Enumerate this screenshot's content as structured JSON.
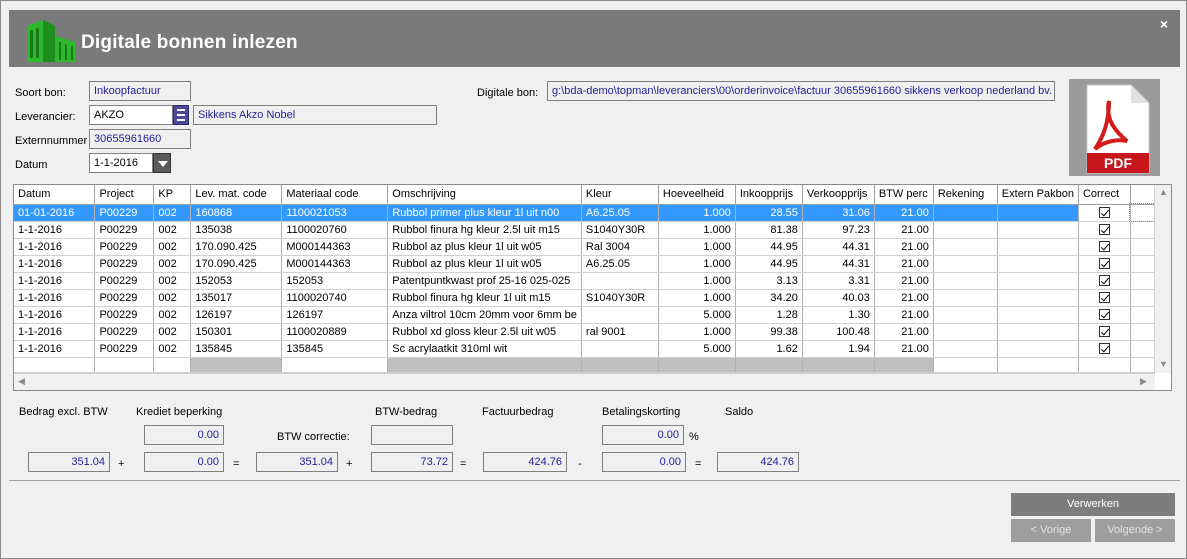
{
  "window": {
    "title": "Digitale bonnen inlezen",
    "close_glyph": "×"
  },
  "form": {
    "soort_bon_label": "Soort bon:",
    "soort_bon_value": "Inkoopfactuur",
    "leverancier_label": "Leverancier:",
    "leverancier_code": "AKZO",
    "leverancier_name": "Sikkens Akzo Nobel",
    "externnummer_label": "Externnummer",
    "externnummer_value": "30655961660",
    "datum_label": "Datum",
    "datum_value": "1-1-2016",
    "digitale_bon_label": "Digitale bon:",
    "digitale_bon_value": "g:\\bda-demo\\topman\\leveranciers\\00\\orderinvoice\\factuur 30655961660 sikkens verkoop nederland bv.",
    "pdf_icon": "pdf-file-icon"
  },
  "grid": {
    "columns": [
      "Datum",
      "Project",
      "KP",
      "Lev. mat. code",
      "Materiaal code",
      "Omschrijving",
      "Kleur",
      "Hoeveelheid",
      "Inkoopprijs",
      "Verkoopprijs",
      "BTW perc",
      "Rekening",
      "Extern Pakbon",
      "Correct"
    ],
    "rows": [
      [
        "01-01-2016",
        "P00229",
        "002",
        "160868",
        "1100021053",
        "Rubbol primer plus kleur 1l uit n00",
        "A6.25.05",
        "1.000",
        "28.55",
        "31.06",
        "21.00",
        "",
        ""
      ],
      [
        "1-1-2016",
        "P00229",
        "002",
        "135038",
        "1100020760",
        "Rubbol finura hg kleur 2.5l uit m15",
        "S1040Y30R",
        "1.000",
        "81.38",
        "97.23",
        "21.00",
        "",
        ""
      ],
      [
        "1-1-2016",
        "P00229",
        "002",
        "170.090.425",
        "M000144363",
        "Rubbol az plus kleur 1l uit w05",
        "Ral 3004",
        "1.000",
        "44.95",
        "44.31",
        "21.00",
        "",
        ""
      ],
      [
        "1-1-2016",
        "P00229",
        "002",
        "170.090.425",
        "M000144363",
        "Rubbol az plus kleur 1l uit w05",
        "A6.25.05",
        "1.000",
        "44.95",
        "44.31",
        "21.00",
        "",
        ""
      ],
      [
        "1-1-2016",
        "P00229",
        "002",
        "152053",
        "152053",
        "Patentpuntkwast prof 25-16 025-025",
        "",
        "1.000",
        "3.13",
        "3.31",
        "21.00",
        "",
        ""
      ],
      [
        "1-1-2016",
        "P00229",
        "002",
        "135017",
        "1100020740",
        "Rubbol finura hg kleur 1l uit m15",
        "S1040Y30R",
        "1.000",
        "34.20",
        "40.03",
        "21.00",
        "",
        ""
      ],
      [
        "1-1-2016",
        "P00229",
        "002",
        "126197",
        "126197",
        "Anza viltrol 10cm 20mm voor 6mm be",
        "",
        "5.000",
        "1.28",
        "1.30",
        "21.00",
        "",
        ""
      ],
      [
        "1-1-2016",
        "P00229",
        "002",
        "150301",
        "1100020889",
        "Rubbol xd gloss kleur 2.5l uit w05",
        "ral 9001",
        "1.000",
        "99.38",
        "100.48",
        "21.00",
        "",
        ""
      ],
      [
        "1-1-2016",
        "P00229",
        "002",
        "135845",
        "135845",
        "Sc acrylaatkit 310ml wit",
        "",
        "5.000",
        "1.62",
        "1.94",
        "21.00",
        "",
        ""
      ]
    ],
    "correct_checked": [
      true,
      true,
      true,
      true,
      true,
      true,
      true,
      true,
      true
    ]
  },
  "totals": {
    "bedrag_excl_label": "Bedrag excl. BTW",
    "krediet_label": "Krediet beperking",
    "btw_bedrag_label": "BTW-bedrag",
    "factuur_label": "Factuurbedrag",
    "betalingskorting_label": "Betalingskorting",
    "saldo_label": "Saldo",
    "btw_correctie_label": "BTW correctie:",
    "krediet_top": "0.00",
    "btw_correctie_value": "",
    "korting_percent": "0.00",
    "percent_sign": "%",
    "bedrag_excl": "351.04",
    "krediet": "0.00",
    "subtotal": "351.04",
    "btw_bedrag": "73.72",
    "factuurbedrag": "424.76",
    "korting": "0.00",
    "saldo": "424.76",
    "op_plus1": "+",
    "op_eq1": "=",
    "op_plus2": "+",
    "op_eq2": "=",
    "op_minus": "-",
    "op_eq3": "="
  },
  "buttons": {
    "verwerken": "Verwerken",
    "vorige": "< Vorige",
    "volgende": "Volgende >"
  }
}
